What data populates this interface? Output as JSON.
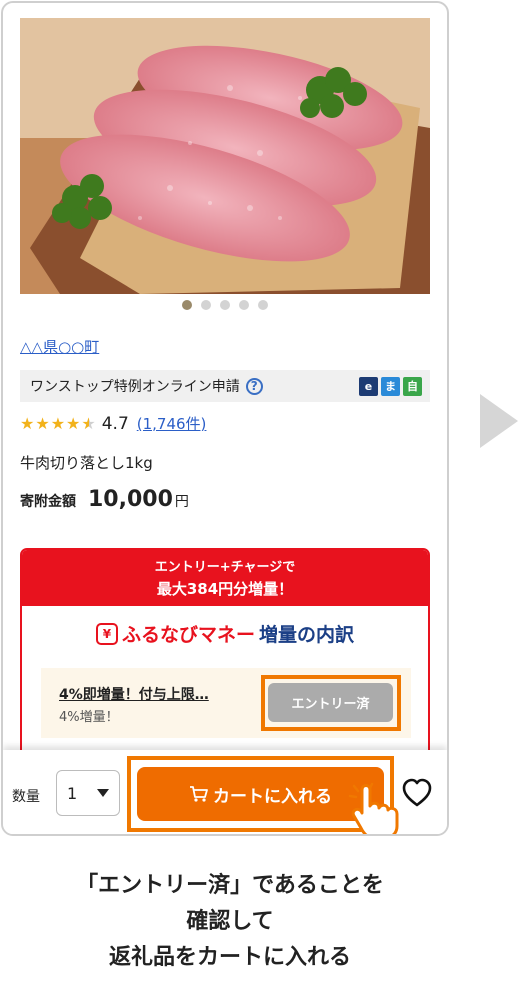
{
  "product": {
    "region": "△△県○○町",
    "onestop_label": "ワンストップ特例オンライン申請",
    "help_icon": "question-circle-icon",
    "badges": [
      {
        "text": "e",
        "color": "#1d3b73"
      },
      {
        "text": "ま",
        "color": "#2a8ad8"
      },
      {
        "text": "自",
        "color": "#3aa64a"
      }
    ],
    "rating_value": 4.7,
    "rating_text": "4.7",
    "review_count": "(1,746件)",
    "name": "牛肉切り落とし1kg",
    "price_label": "寄附金額",
    "price": "10,000",
    "price_unit": "円"
  },
  "carousel": {
    "count": 5,
    "active": 1
  },
  "promo": {
    "header_line1": "エントリー+チャージで",
    "header_line2": "最大384円分増量！",
    "wallet_icon": "wallet-icon",
    "brand": "ふるなびマネー",
    "title": "増量の内訳",
    "offer_title": "4%即増量！付与上限…",
    "offer_sub": "4%増量！",
    "entry_button": "エントリー済"
  },
  "footer": {
    "qty_label": "数量",
    "qty_value": "1",
    "cart_button": "カートに入れる",
    "cart_icon": "cart-icon",
    "favorite_icon": "heart-icon"
  },
  "instruction": {
    "line1": "「エントリー済」であることを",
    "line2": "確認して",
    "line3": "返礼品をカートに入れる"
  },
  "colors": {
    "accent_red": "#e8121e",
    "accent_orange": "#ef6c00",
    "link_blue": "#2b5ec7",
    "navy": "#1b3f86"
  }
}
